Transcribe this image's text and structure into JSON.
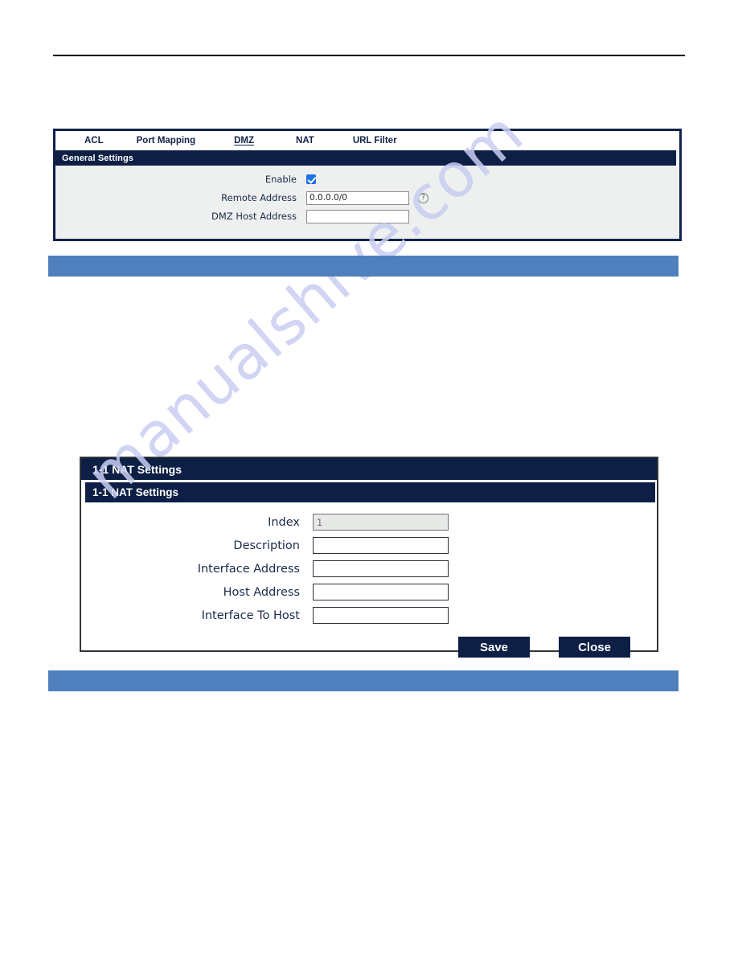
{
  "page": {
    "watermark_text": "manualshive.com",
    "accent_blue": "#4f80bd",
    "navy": "#0d1f45",
    "checkbox_blue": "#1a73e8"
  },
  "dmz_panel": {
    "tabs": [
      {
        "label": "ACL",
        "active": false
      },
      {
        "label": "Port Mapping",
        "active": false
      },
      {
        "label": "DMZ",
        "active": true
      },
      {
        "label": "NAT",
        "active": false
      },
      {
        "label": "URL Filter",
        "active": false
      }
    ],
    "section_title": "General Settings",
    "fields": [
      {
        "label": "Enable",
        "type": "checkbox",
        "checked": true
      },
      {
        "label": "Remote Address",
        "type": "text",
        "value": "0.0.0.0/0",
        "help": "?"
      },
      {
        "label": "DMZ Host Address",
        "type": "text",
        "value": ""
      }
    ],
    "help_icon": "?"
  },
  "nat_panel": {
    "window_title": "1-1 NAT Settings",
    "section_title": "1-1 NAT Settings",
    "fields": [
      {
        "label": "Index",
        "value": "1",
        "readonly": true
      },
      {
        "label": "Description",
        "value": "",
        "readonly": false
      },
      {
        "label": "Interface Address",
        "value": "",
        "readonly": false
      },
      {
        "label": "Host Address",
        "value": "",
        "readonly": false
      },
      {
        "label": "Interface To Host",
        "value": "",
        "readonly": false
      }
    ],
    "save_label": "Save",
    "close_label": "Close"
  }
}
